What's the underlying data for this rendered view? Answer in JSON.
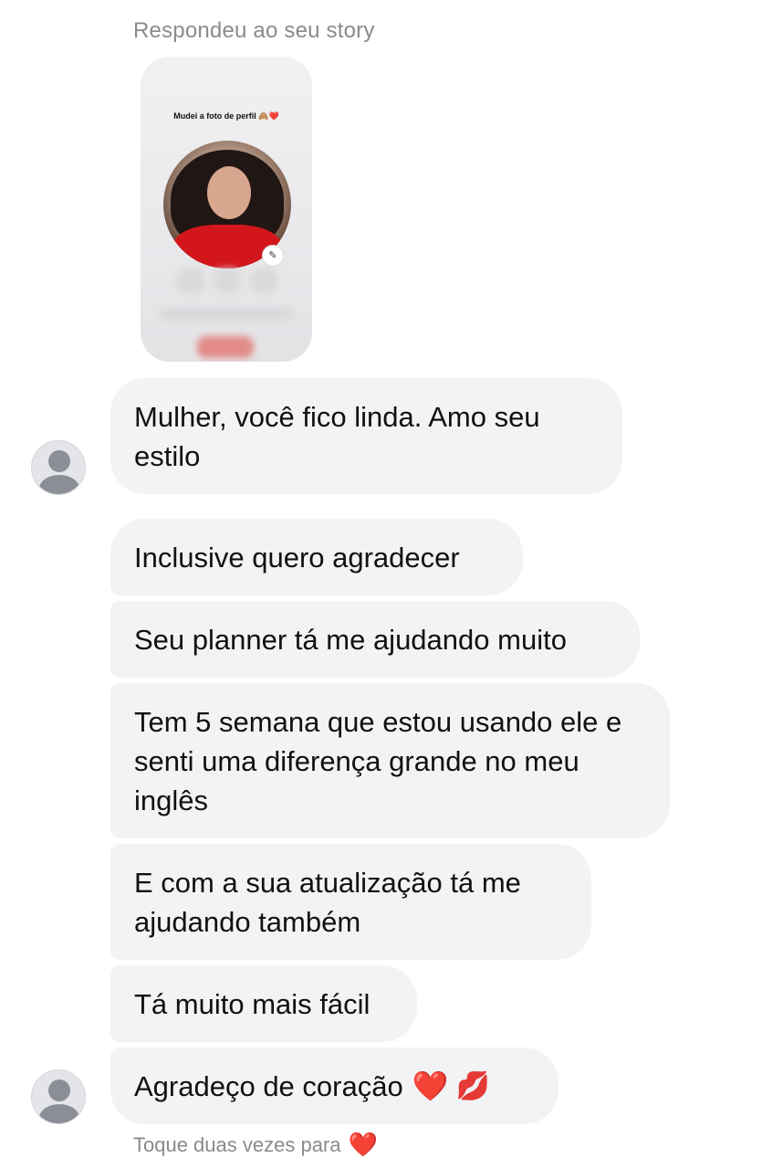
{
  "story_reply": {
    "label": "Respondeu ao seu story",
    "caption": "Mudei a foto de perfil 🙈❤️",
    "edit_icon": "pencil-icon"
  },
  "messages": [
    {
      "text": "Mulher, você fico linda. Amo seu estilo"
    },
    {
      "text": "Inclusive quero agradecer"
    },
    {
      "text": "Seu planner tá me ajudando muito"
    },
    {
      "text": "Tem 5 semana que estou usando ele e senti uma diferença grande no meu inglês"
    },
    {
      "text": "E com a sua atualização tá me ajudando também"
    },
    {
      "text": "Tá muito mais fácil"
    },
    {
      "text": "Agradeço de coração",
      "emoji_1": "❤️",
      "emoji_2": "💋"
    }
  ],
  "footer": {
    "hint": "Toque duas vezes para",
    "hint_emoji": "❤️"
  },
  "colors": {
    "bubble_bg": "#f2f3f5",
    "meta_text": "#8a8a8e",
    "heart": "#e0182d"
  }
}
